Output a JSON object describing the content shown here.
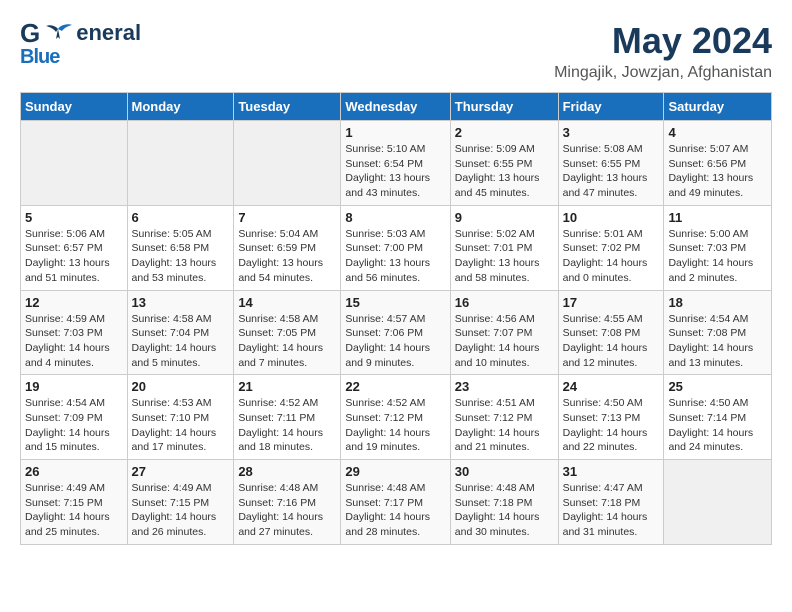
{
  "header": {
    "logo_general": "General",
    "logo_blue": "Blue",
    "month": "May 2024",
    "location": "Mingajik, Jowzjan, Afghanistan"
  },
  "weekdays": [
    "Sunday",
    "Monday",
    "Tuesday",
    "Wednesday",
    "Thursday",
    "Friday",
    "Saturday"
  ],
  "weeks": [
    [
      {
        "day": "",
        "info": ""
      },
      {
        "day": "",
        "info": ""
      },
      {
        "day": "",
        "info": ""
      },
      {
        "day": "1",
        "info": "Sunrise: 5:10 AM\nSunset: 6:54 PM\nDaylight: 13 hours\nand 43 minutes."
      },
      {
        "day": "2",
        "info": "Sunrise: 5:09 AM\nSunset: 6:55 PM\nDaylight: 13 hours\nand 45 minutes."
      },
      {
        "day": "3",
        "info": "Sunrise: 5:08 AM\nSunset: 6:55 PM\nDaylight: 13 hours\nand 47 minutes."
      },
      {
        "day": "4",
        "info": "Sunrise: 5:07 AM\nSunset: 6:56 PM\nDaylight: 13 hours\nand 49 minutes."
      }
    ],
    [
      {
        "day": "5",
        "info": "Sunrise: 5:06 AM\nSunset: 6:57 PM\nDaylight: 13 hours\nand 51 minutes."
      },
      {
        "day": "6",
        "info": "Sunrise: 5:05 AM\nSunset: 6:58 PM\nDaylight: 13 hours\nand 53 minutes."
      },
      {
        "day": "7",
        "info": "Sunrise: 5:04 AM\nSunset: 6:59 PM\nDaylight: 13 hours\nand 54 minutes."
      },
      {
        "day": "8",
        "info": "Sunrise: 5:03 AM\nSunset: 7:00 PM\nDaylight: 13 hours\nand 56 minutes."
      },
      {
        "day": "9",
        "info": "Sunrise: 5:02 AM\nSunset: 7:01 PM\nDaylight: 13 hours\nand 58 minutes."
      },
      {
        "day": "10",
        "info": "Sunrise: 5:01 AM\nSunset: 7:02 PM\nDaylight: 14 hours\nand 0 minutes."
      },
      {
        "day": "11",
        "info": "Sunrise: 5:00 AM\nSunset: 7:03 PM\nDaylight: 14 hours\nand 2 minutes."
      }
    ],
    [
      {
        "day": "12",
        "info": "Sunrise: 4:59 AM\nSunset: 7:03 PM\nDaylight: 14 hours\nand 4 minutes."
      },
      {
        "day": "13",
        "info": "Sunrise: 4:58 AM\nSunset: 7:04 PM\nDaylight: 14 hours\nand 5 minutes."
      },
      {
        "day": "14",
        "info": "Sunrise: 4:58 AM\nSunset: 7:05 PM\nDaylight: 14 hours\nand 7 minutes."
      },
      {
        "day": "15",
        "info": "Sunrise: 4:57 AM\nSunset: 7:06 PM\nDaylight: 14 hours\nand 9 minutes."
      },
      {
        "day": "16",
        "info": "Sunrise: 4:56 AM\nSunset: 7:07 PM\nDaylight: 14 hours\nand 10 minutes."
      },
      {
        "day": "17",
        "info": "Sunrise: 4:55 AM\nSunset: 7:08 PM\nDaylight: 14 hours\nand 12 minutes."
      },
      {
        "day": "18",
        "info": "Sunrise: 4:54 AM\nSunset: 7:08 PM\nDaylight: 14 hours\nand 13 minutes."
      }
    ],
    [
      {
        "day": "19",
        "info": "Sunrise: 4:54 AM\nSunset: 7:09 PM\nDaylight: 14 hours\nand 15 minutes."
      },
      {
        "day": "20",
        "info": "Sunrise: 4:53 AM\nSunset: 7:10 PM\nDaylight: 14 hours\nand 17 minutes."
      },
      {
        "day": "21",
        "info": "Sunrise: 4:52 AM\nSunset: 7:11 PM\nDaylight: 14 hours\nand 18 minutes."
      },
      {
        "day": "22",
        "info": "Sunrise: 4:52 AM\nSunset: 7:12 PM\nDaylight: 14 hours\nand 19 minutes."
      },
      {
        "day": "23",
        "info": "Sunrise: 4:51 AM\nSunset: 7:12 PM\nDaylight: 14 hours\nand 21 minutes."
      },
      {
        "day": "24",
        "info": "Sunrise: 4:50 AM\nSunset: 7:13 PM\nDaylight: 14 hours\nand 22 minutes."
      },
      {
        "day": "25",
        "info": "Sunrise: 4:50 AM\nSunset: 7:14 PM\nDaylight: 14 hours\nand 24 minutes."
      }
    ],
    [
      {
        "day": "26",
        "info": "Sunrise: 4:49 AM\nSunset: 7:15 PM\nDaylight: 14 hours\nand 25 minutes."
      },
      {
        "day": "27",
        "info": "Sunrise: 4:49 AM\nSunset: 7:15 PM\nDaylight: 14 hours\nand 26 minutes."
      },
      {
        "day": "28",
        "info": "Sunrise: 4:48 AM\nSunset: 7:16 PM\nDaylight: 14 hours\nand 27 minutes."
      },
      {
        "day": "29",
        "info": "Sunrise: 4:48 AM\nSunset: 7:17 PM\nDaylight: 14 hours\nand 28 minutes."
      },
      {
        "day": "30",
        "info": "Sunrise: 4:48 AM\nSunset: 7:18 PM\nDaylight: 14 hours\nand 30 minutes."
      },
      {
        "day": "31",
        "info": "Sunrise: 4:47 AM\nSunset: 7:18 PM\nDaylight: 14 hours\nand 31 minutes."
      },
      {
        "day": "",
        "info": ""
      }
    ]
  ]
}
